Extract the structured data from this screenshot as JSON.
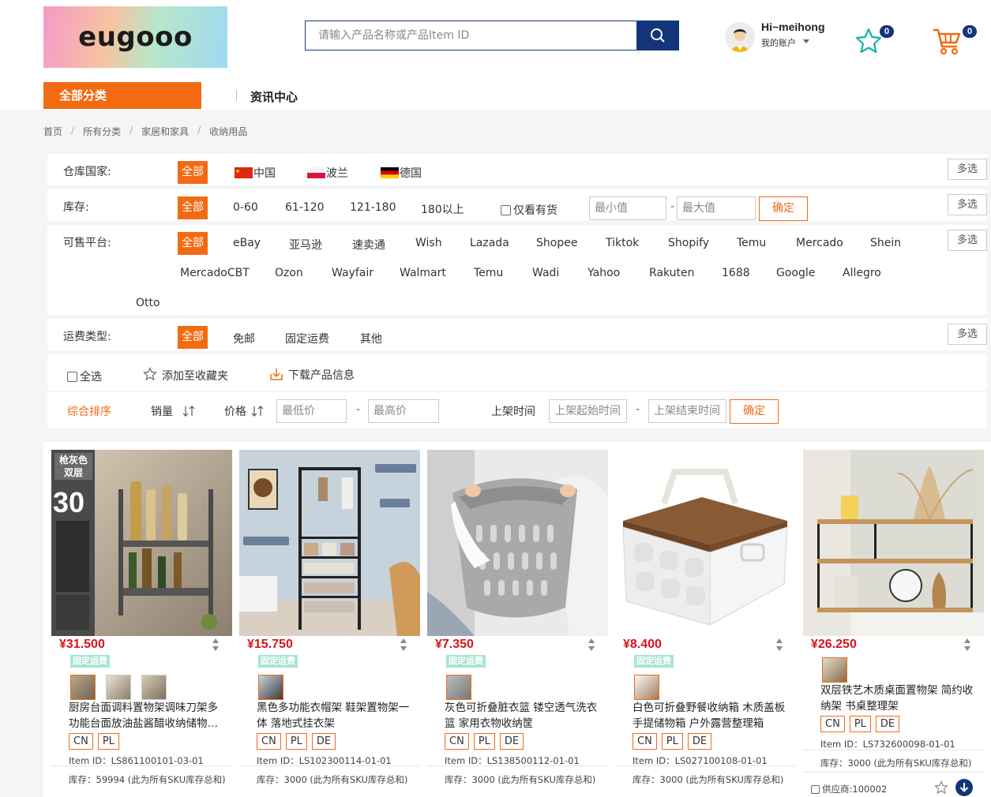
{
  "header": {
    "logo_text": "eugooo",
    "search_placeholder": "请输入产品名称或产品Item ID",
    "greeting": "Hi~meihong",
    "account_label": "我的账户",
    "favorites_count": "0",
    "cart_count": "0"
  },
  "nav": {
    "categories_label": "全部分类",
    "news_label": "资讯中心"
  },
  "breadcrumb": [
    "首页",
    "所有分类",
    "家居和家具",
    "收纳用品"
  ],
  "filters": {
    "multi_label": "多选",
    "all_label": "全部",
    "warehouse": {
      "label": "仓库国家:",
      "options": [
        "中国",
        "波兰",
        "德国"
      ]
    },
    "stock": {
      "label": "库存:",
      "options": [
        "0-60",
        "61-120",
        "121-180",
        "180以上"
      ],
      "in_stock_label": "仅看有货",
      "min_placeholder": "最小值",
      "max_placeholder": "最大值",
      "confirm_label": "确定"
    },
    "platform": {
      "label": "可售平台:",
      "options": [
        "eBay",
        "亚马逊",
        "速卖通",
        "Wish",
        "Lazada",
        "Shopee",
        "Tiktok",
        "Shopify",
        "Temu",
        "Mercado",
        "Shein",
        "MercadoCBT",
        "Ozon",
        "Wayfair",
        "Walmart",
        "Temu",
        "Wadi",
        "Yahoo",
        "Rakuten",
        "1688",
        "Google",
        "Allegro",
        "Otto"
      ]
    },
    "shipping": {
      "label": "运费类型:",
      "options": [
        "免邮",
        "固定运费",
        "其他"
      ]
    }
  },
  "actions": {
    "select_all": "全选",
    "add_favorites": "添加至收藏夹",
    "download": "下载产品信息"
  },
  "sort": {
    "default_label": "综合排序",
    "sales_label": "销量",
    "price_label": "价格",
    "min_price_placeholder": "最低价",
    "max_price_placeholder": "最高价",
    "listing_time_label": "上架时间",
    "start_placeholder": "上架起始时间",
    "end_placeholder": "上架结束时间",
    "confirm_label": "确定"
  },
  "products": [
    {
      "price": "¥31.500",
      "shipping": "固定运费",
      "title": "厨房台面调料置物架调味刀架多功能台面放油盐酱醋收纳储物…",
      "tags": [
        "CN",
        "PL"
      ],
      "item_id": "Item ID：LS861100101-03-01",
      "stock": "库存：59994 (此为所有SKU库存总和)",
      "image_badge_top": "枪灰色",
      "image_badge_bottom": "双层",
      "image_big_number": "30"
    },
    {
      "price": "¥15.750",
      "shipping": "固定运费",
      "title": "黑色多功能衣帽架 鞋架置物架一体 落地式挂衣架",
      "tags": [
        "CN",
        "PL",
        "DE"
      ],
      "item_id": "Item ID：LS102300114-01-01",
      "stock": "库存：3000 (此为所有SKU库存总和)"
    },
    {
      "price": "¥7.350",
      "shipping": "固定运费",
      "title": "灰色可折叠脏衣篮 镂空透气洗衣篮 家用衣物收纳筐",
      "tags": [
        "CN",
        "PL",
        "DE"
      ],
      "item_id": "Item ID：LS138500112-01-01",
      "stock": "库存：3000 (此为所有SKU库存总和)"
    },
    {
      "price": "¥8.400",
      "shipping": "固定运费",
      "title": "白色可折叠野餐收纳箱 木质盖板手提储物箱 户外露营整理箱",
      "tags": [
        "CN",
        "PL",
        "DE"
      ],
      "item_id": "Item ID：LS027100108-01-01",
      "stock": "库存：3000 (此为所有SKU库存总和)"
    },
    {
      "price": "¥26.250",
      "shipping": "",
      "title": "双层铁艺木质桌面置物架 简约收纳架 书桌整理架",
      "tags": [
        "CN",
        "PL",
        "DE"
      ],
      "item_id": "Item ID：LS732600098-01-01",
      "stock": "库存：3000 (此为所有SKU库存总和)",
      "supplier": "供应商:100002"
    }
  ]
}
